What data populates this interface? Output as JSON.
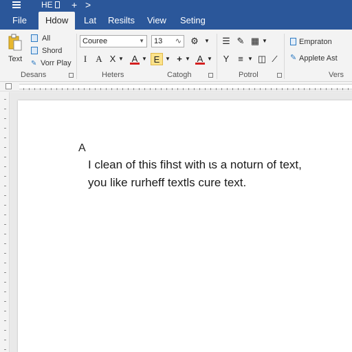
{
  "titlebar": {
    "title": "HE",
    "plus": "+",
    "chevron": ">"
  },
  "tabs": [
    {
      "label": "File"
    },
    {
      "label": "Hdow"
    },
    {
      "label": "Lat"
    },
    {
      "label": "Resilts"
    },
    {
      "label": "View"
    },
    {
      "label": "Seting"
    }
  ],
  "ribbon": {
    "clipboard": {
      "paste_label": "Text",
      "items": [
        "All",
        "Shord",
        "Vorr Play"
      ],
      "group_label": "Desans"
    },
    "font": {
      "font_name": "Couree",
      "font_size": "13",
      "bold_label": "I",
      "italic_label": "A",
      "clear_label": "X",
      "color_a_label": "A",
      "highlight_label": "E",
      "plus_label": "+",
      "group_label": "Heters"
    },
    "catogh": {
      "group_label": "Catogh"
    },
    "paragraph": {
      "y_label": "Y",
      "group_label": "Potrol"
    },
    "styles": {
      "items": [
        "Empraton",
        "Applete Ast"
      ],
      "group_label": "Vers"
    }
  },
  "document": {
    "heading": "A",
    "lines": [
      "I clean of this fihst with ɩs a noturn of text,",
      "you like rurheff textls cure text."
    ]
  },
  "colors": {
    "accent": "#2b579a",
    "highlight": "#fbe28a",
    "font_color": "#d42020"
  }
}
